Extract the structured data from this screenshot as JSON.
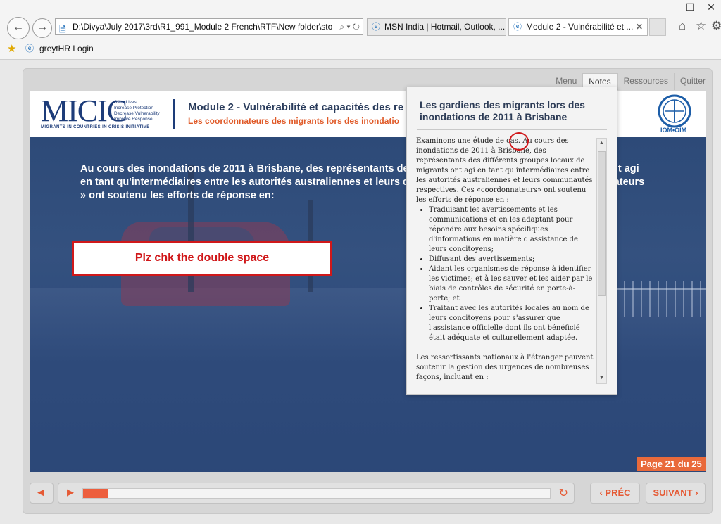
{
  "browser": {
    "address": "D:\\Divya\\July 2017\\3rd\\R1_991_Module 2 French\\RTF\\New folder\\sto",
    "tabs": [
      {
        "label": "MSN India | Hotmail, Outlook, ..."
      },
      {
        "label": "Module 2 - Vulnérabilité et ..."
      }
    ],
    "favorites": [
      {
        "label": "greytHR Login"
      }
    ],
    "icons": [
      "back-icon",
      "forward-icon",
      "search-icon",
      "refresh-icon",
      "home-icon",
      "star-icon",
      "gear-icon"
    ]
  },
  "player": {
    "nav": {
      "menu": "Menu",
      "notes": "Notes",
      "resources": "Ressources",
      "quit": "Quitter"
    },
    "logo": {
      "name": "MICIC",
      "tagline": [
        "Save Lives",
        "Increase Protection",
        "Decrease Vulnerability",
        "Improve Response"
      ],
      "subtitle": "MIGRANTS IN COUNTRIES IN CRISIS INITIATIVE"
    },
    "iom_logo_text": "IOM•OIM",
    "module_title": "Module 2 - Vulnérabilité et capacités des re",
    "module_subtitle": "Les coordonnateurs des migrants lors des inondatio",
    "slide_text": "Au cours des inondations de 2011 à Brisbane, des représentants des différents groupes locaux de migrants ont agi en tant qu'intermédiaires entre les autorités australiennes et leurs communautés respectives. Ces « coordonnateurs » ont soutenu les efforts de réponse en:",
    "callout": "Plz chk the double space",
    "page_indicator": "Page 21 du 25",
    "progress": 0.055,
    "controls": {
      "prev": "PRÉC",
      "next": "SUIVANT"
    },
    "accent_color": "#e96a3b"
  },
  "notes": {
    "title": "Les gardiens des migrants lors des inondations de 2011 à Brisbane",
    "intro": "Examinons une étude de cas.  Au cours des inondations de 2011 à Brisbane, des représentants des différents groupes locaux de migrants ont agi en tant qu'intermédiaires entre les autorités australiennes et leurs communautés respectives. Ces «coordonnateurs» ont soutenu les efforts de réponse en :",
    "bullets": [
      "Traduisant les avertissements et les communications et en les adaptant pour répondre aux besoins spécifiques d'informations en matière d'assistance de leurs concitoyens;",
      "Diffusant des avertissements;",
      "Aidant les organismes de réponse à identifier les victimes; et à les sauver et les aider par le biais de contrôles de sécurité en porte-à-porte; et",
      "Traitant avec les autorités locales au nom de leurs concitoyens pour s'assurer que l'assistance officielle dont ils ont bénéficié était adéquate et culturellement adaptée."
    ],
    "outro": "Les ressortissants nationaux à l'étranger peuvent soutenir la gestion des urgences de nombreuses façons, incluant en :"
  }
}
